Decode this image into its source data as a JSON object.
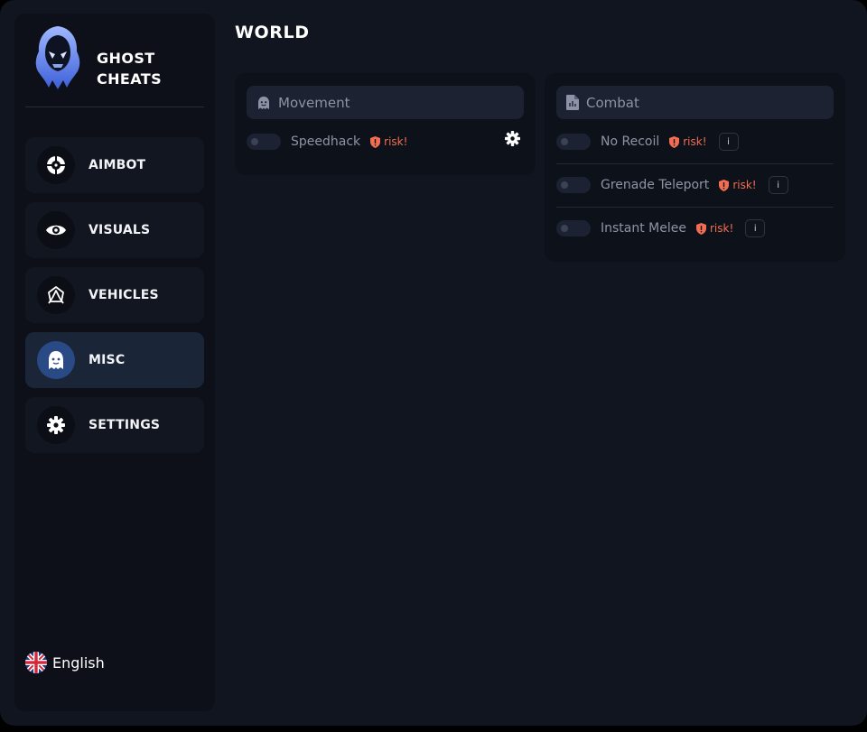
{
  "brand": {
    "name_line1": "GHOST",
    "name_line2": "CHEATS",
    "logo_icon": "hooded-ghost-logo"
  },
  "page": {
    "title": "WORLD"
  },
  "sidebar": {
    "items": [
      {
        "label": "AIMBOT",
        "icon": "crosshair-icon",
        "active": false
      },
      {
        "label": "VISUALS",
        "icon": "eye-icon",
        "active": false
      },
      {
        "label": "VEHICLES",
        "icon": "vehicle-icon",
        "active": false
      },
      {
        "label": "MISC",
        "icon": "ghost-icon",
        "active": true
      },
      {
        "label": "SETTINGS",
        "icon": "gear-icon",
        "active": false
      }
    ],
    "language": {
      "label": "English",
      "icon": "uk-flag-icon"
    }
  },
  "panels": {
    "movement": {
      "title": "Movement",
      "icon": "ghost-icon",
      "rows": [
        {
          "label": "Speedhack",
          "risk": "risk!",
          "enabled": false,
          "has_settings": true
        }
      ]
    },
    "combat": {
      "title": "Combat",
      "icon": "document-icon",
      "rows": [
        {
          "label": "No Recoil",
          "risk": "risk!",
          "enabled": false,
          "info": "i"
        },
        {
          "label": "Grenade Teleport",
          "risk": "risk!",
          "enabled": false,
          "info": "i"
        },
        {
          "label": "Instant Melee",
          "risk": "risk!",
          "enabled": false,
          "info": "i"
        }
      ]
    }
  },
  "colors": {
    "background": "#111520",
    "sidebar": "#0d1018",
    "active_nav": "#1b2538",
    "accent": "#2a4a85",
    "risk": "#f36d52"
  }
}
